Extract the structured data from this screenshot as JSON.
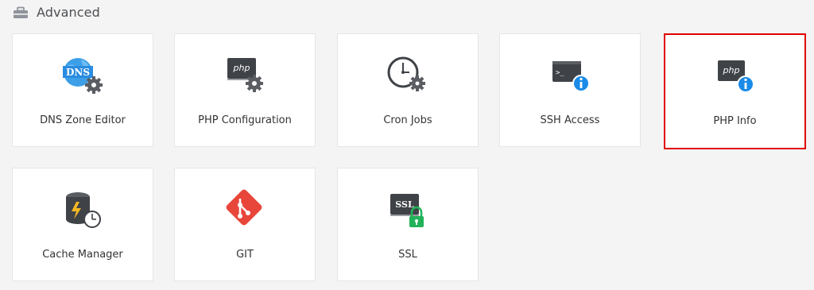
{
  "section": {
    "title": "Advanced",
    "icon": "toolbox-icon"
  },
  "tiles": [
    {
      "label": "DNS Zone Editor",
      "icon": "dns-gear-icon"
    },
    {
      "label": "PHP Configuration",
      "icon": "php-gear-icon"
    },
    {
      "label": "Cron Jobs",
      "icon": "clock-gear-icon"
    },
    {
      "label": "SSH Access",
      "icon": "terminal-info-icon"
    },
    {
      "label": "PHP Info",
      "icon": "php-info-icon",
      "selected": true
    },
    {
      "label": "Cache Manager",
      "icon": "database-clock-icon"
    },
    {
      "label": "GIT",
      "icon": "git-icon"
    },
    {
      "label": "SSL",
      "icon": "ssl-lock-icon"
    }
  ],
  "colors": {
    "highlight": "#e00000",
    "icon_dark": "#3f4247",
    "info_blue": "#1a8be8",
    "git_red": "#e8463a",
    "lock_green": "#22b35a",
    "globe_blue": "#3d9fe8"
  }
}
